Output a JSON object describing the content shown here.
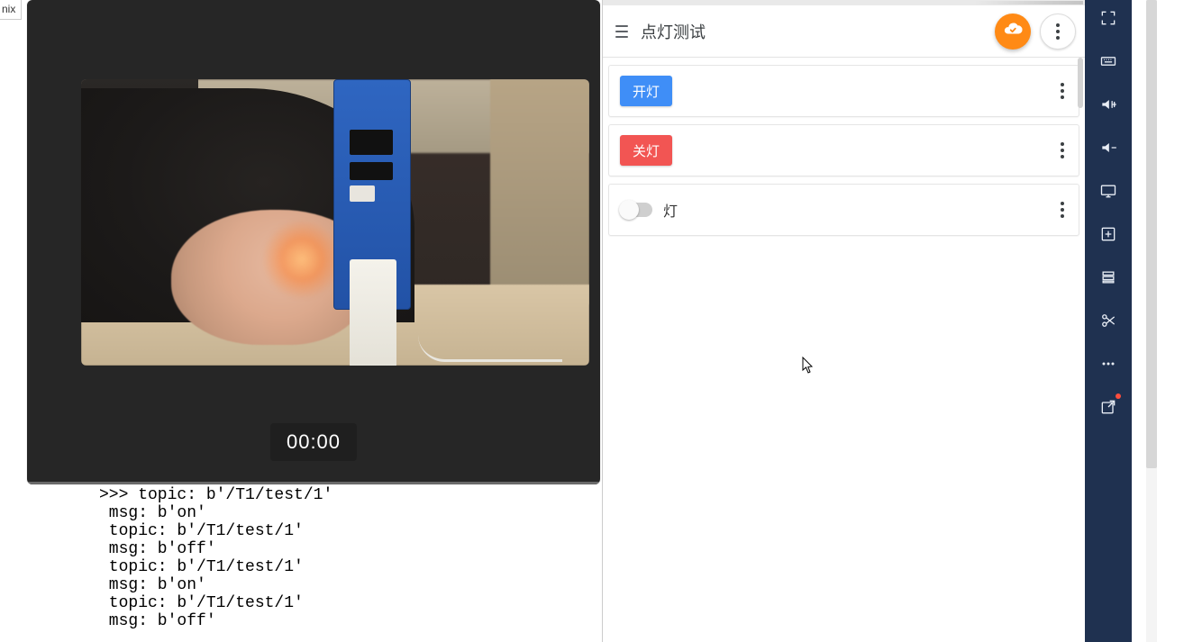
{
  "left": {
    "tab_label": "nix",
    "timer": "00:00",
    "console_lines": [
      ">>> topic: b'/T1/test/1'",
      " msg: b'on'",
      " topic: b'/T1/test/1'",
      " msg: b'off'",
      " topic: b'/T1/test/1'",
      " msg: b'on'",
      " topic: b'/T1/test/1'",
      " msg: b'off'"
    ]
  },
  "app": {
    "title": "点灯测试",
    "cards": [
      {
        "type": "button",
        "label": "开灯",
        "color": "blue"
      },
      {
        "type": "button",
        "label": "关灯",
        "color": "red"
      },
      {
        "type": "switch",
        "label": "灯",
        "value": false
      }
    ]
  },
  "sidebar_icons": [
    "keyboard-icon",
    "volume-up-icon",
    "volume-down-icon",
    "monitor-icon",
    "add-apk-icon",
    "stack-icon",
    "scissors-icon",
    "more-icon",
    "open-external-icon"
  ],
  "colors": {
    "accent_orange": "#ff8a15",
    "button_blue": "#3f8ef7",
    "button_red": "#f25553",
    "sidebar_bg": "#1f3150"
  }
}
